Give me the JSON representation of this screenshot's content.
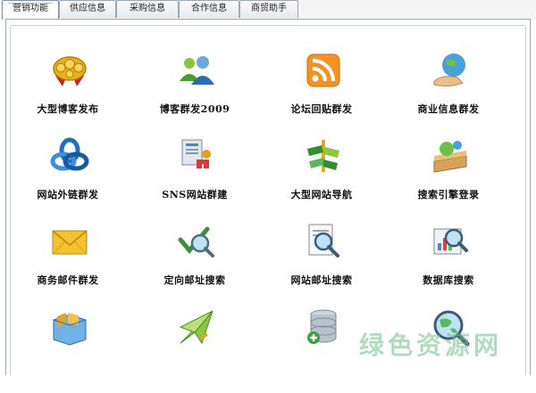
{
  "tabs": [
    {
      "label": "营销功能",
      "active": true
    },
    {
      "label": "供应信息",
      "active": false
    },
    {
      "label": "采购信息",
      "active": false
    },
    {
      "label": "合作信息",
      "active": false
    },
    {
      "label": "商贸助手",
      "active": false
    }
  ],
  "features": [
    {
      "label": "大型博客发布",
      "icon": "gold-badge-icon"
    },
    {
      "label": "博客群发2009",
      "icon": "users-icon"
    },
    {
      "label": "论坛回贴群发",
      "icon": "rss-icon"
    },
    {
      "label": "商业信息群发",
      "icon": "globe-hand-icon"
    },
    {
      "label": "网站外链群发",
      "icon": "blue-knot-icon"
    },
    {
      "label": "SNS网站群建",
      "icon": "document-magnet-icon"
    },
    {
      "label": "大型网站导航",
      "icon": "signpost-icon"
    },
    {
      "label": "搜索引擎登录",
      "icon": "globe-search-icon"
    },
    {
      "label": "商务邮件群发",
      "icon": "envelope-icon"
    },
    {
      "label": "定向邮址搜索",
      "icon": "check-magnifier-icon"
    },
    {
      "label": "网站邮址搜索",
      "icon": "page-magnifier-icon"
    },
    {
      "label": "数据库搜索",
      "icon": "chart-magnifier-icon"
    },
    {
      "label": "",
      "icon": "box-icon"
    },
    {
      "label": "",
      "icon": "paper-plane-icon"
    },
    {
      "label": "",
      "icon": "database-add-icon"
    },
    {
      "label": "",
      "icon": "globe-magnifier-icon"
    }
  ],
  "watermark": "绿色资源网"
}
